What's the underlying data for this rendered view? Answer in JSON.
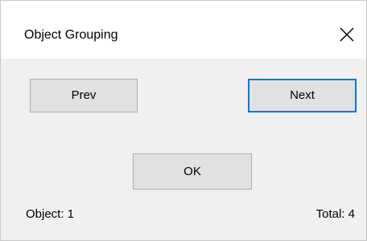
{
  "window": {
    "title": "Object Grouping",
    "close_icon": "close-icon"
  },
  "buttons": {
    "prev_label": "Prev",
    "next_label": "Next",
    "ok_label": "OK"
  },
  "status": {
    "object_text": "Object: 1",
    "total_text": "Total: 4"
  },
  "colors": {
    "titlebar_bg": "#ffffff",
    "dialog_bg": "#f0f0f0",
    "button_bg": "#e1e1e1",
    "button_border": "#adadad",
    "focus_border": "#0078d7"
  }
}
